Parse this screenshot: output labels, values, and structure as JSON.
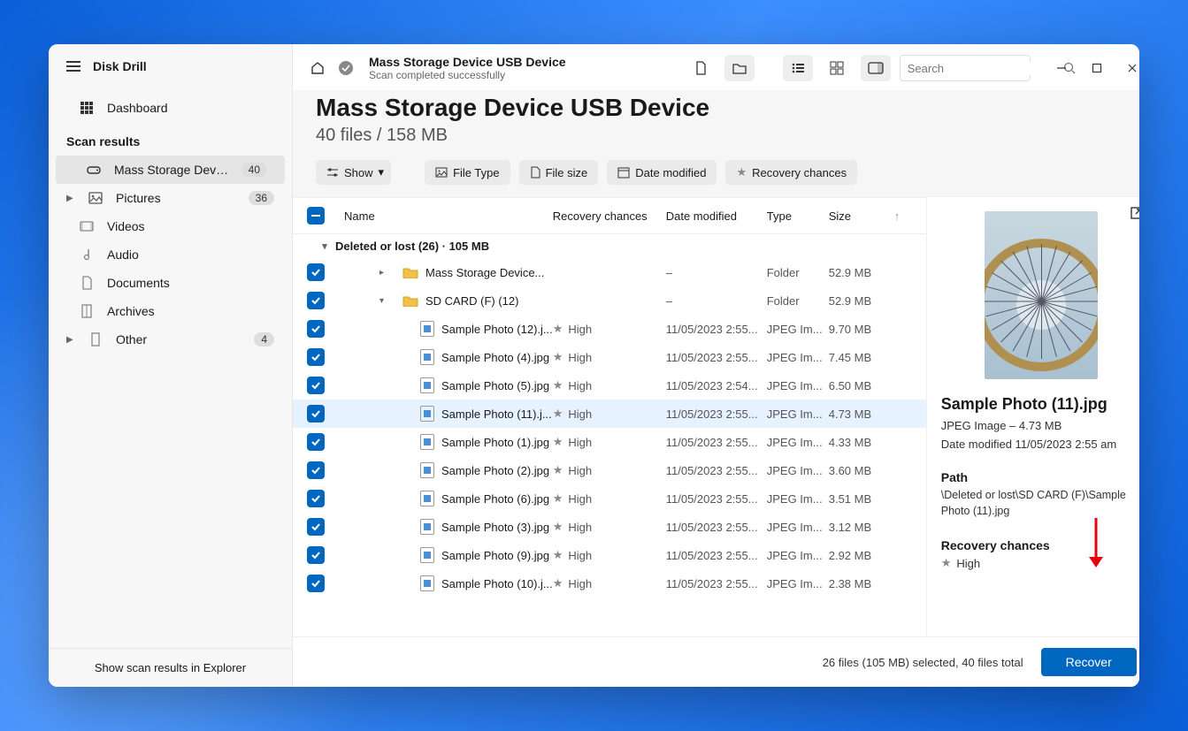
{
  "app": {
    "title": "Disk Drill"
  },
  "sidebar": {
    "dashboard": "Dashboard",
    "section": "Scan results",
    "items": [
      {
        "label": "Mass Storage Device USB...",
        "badge": "40",
        "icon": "disk"
      },
      {
        "label": "Pictures",
        "badge": "36",
        "icon": "picture",
        "expandable": true
      },
      {
        "label": "Videos",
        "icon": "video"
      },
      {
        "label": "Audio",
        "icon": "audio"
      },
      {
        "label": "Documents",
        "icon": "document"
      },
      {
        "label": "Archives",
        "icon": "archive"
      },
      {
        "label": "Other",
        "badge": "4",
        "icon": "other",
        "expandable": true
      }
    ],
    "footer": "Show scan results in Explorer"
  },
  "toolbar": {
    "title": "Mass Storage Device USB Device",
    "subtitle": "Scan completed successfully",
    "search_placeholder": "Search"
  },
  "page": {
    "title": "Mass Storage Device USB Device",
    "subtitle": "40 files / 158 MB"
  },
  "filters": {
    "show": "Show",
    "file_type": "File Type",
    "file_size": "File size",
    "date_modified": "Date modified",
    "recovery": "Recovery chances"
  },
  "columns": {
    "name": "Name",
    "recovery": "Recovery chances",
    "date": "Date modified",
    "type": "Type",
    "size": "Size"
  },
  "group": {
    "label": "Deleted or lost (26) · 105 MB"
  },
  "rows": [
    {
      "indent": 1,
      "chev": "right",
      "icon": "folder",
      "name": "Mass Storage Device...",
      "rec": "",
      "date": "–",
      "type": "Folder",
      "size": "52.9 MB"
    },
    {
      "indent": 1,
      "chev": "down",
      "icon": "folder",
      "name": "SD CARD (F) (12)",
      "rec": "",
      "date": "–",
      "type": "Folder",
      "size": "52.9 MB"
    },
    {
      "indent": 3,
      "icon": "file",
      "name": "Sample Photo (12).j...",
      "rec": "High",
      "date": "11/05/2023 2:55...",
      "type": "JPEG Im...",
      "size": "9.70 MB"
    },
    {
      "indent": 3,
      "icon": "file",
      "name": "Sample Photo (4).jpg",
      "rec": "High",
      "date": "11/05/2023 2:55...",
      "type": "JPEG Im...",
      "size": "7.45 MB"
    },
    {
      "indent": 3,
      "icon": "file",
      "name": "Sample Photo (5).jpg",
      "rec": "High",
      "date": "11/05/2023 2:54...",
      "type": "JPEG Im...",
      "size": "6.50 MB"
    },
    {
      "indent": 3,
      "icon": "file",
      "name": "Sample Photo (11).j...",
      "rec": "High",
      "date": "11/05/2023 2:55...",
      "type": "JPEG Im...",
      "size": "4.73 MB",
      "selected": true
    },
    {
      "indent": 3,
      "icon": "file",
      "name": "Sample Photo (1).jpg",
      "rec": "High",
      "date": "11/05/2023 2:55...",
      "type": "JPEG Im...",
      "size": "4.33 MB"
    },
    {
      "indent": 3,
      "icon": "file",
      "name": "Sample Photo (2).jpg",
      "rec": "High",
      "date": "11/05/2023 2:55...",
      "type": "JPEG Im...",
      "size": "3.60 MB"
    },
    {
      "indent": 3,
      "icon": "file",
      "name": "Sample Photo (6).jpg",
      "rec": "High",
      "date": "11/05/2023 2:55...",
      "type": "JPEG Im...",
      "size": "3.51 MB"
    },
    {
      "indent": 3,
      "icon": "file",
      "name": "Sample Photo (3).jpg",
      "rec": "High",
      "date": "11/05/2023 2:55...",
      "type": "JPEG Im...",
      "size": "3.12 MB"
    },
    {
      "indent": 3,
      "icon": "file",
      "name": "Sample Photo (9).jpg",
      "rec": "High",
      "date": "11/05/2023 2:55...",
      "type": "JPEG Im...",
      "size": "2.92 MB"
    },
    {
      "indent": 3,
      "icon": "file",
      "name": "Sample Photo (10).j...",
      "rec": "High",
      "date": "11/05/2023 2:55...",
      "type": "JPEG Im...",
      "size": "2.38 MB"
    }
  ],
  "preview": {
    "title": "Sample Photo (11).jpg",
    "meta": "JPEG Image – 4.73 MB",
    "date": "Date modified 11/05/2023 2:55 am",
    "path_h": "Path",
    "path": "\\Deleted or lost\\SD CARD (F)\\Sample Photo (11).jpg",
    "rec_h": "Recovery chances",
    "rec": "High"
  },
  "footer": {
    "status": "26 files (105 MB) selected, 40 files total",
    "recover": "Recover"
  }
}
